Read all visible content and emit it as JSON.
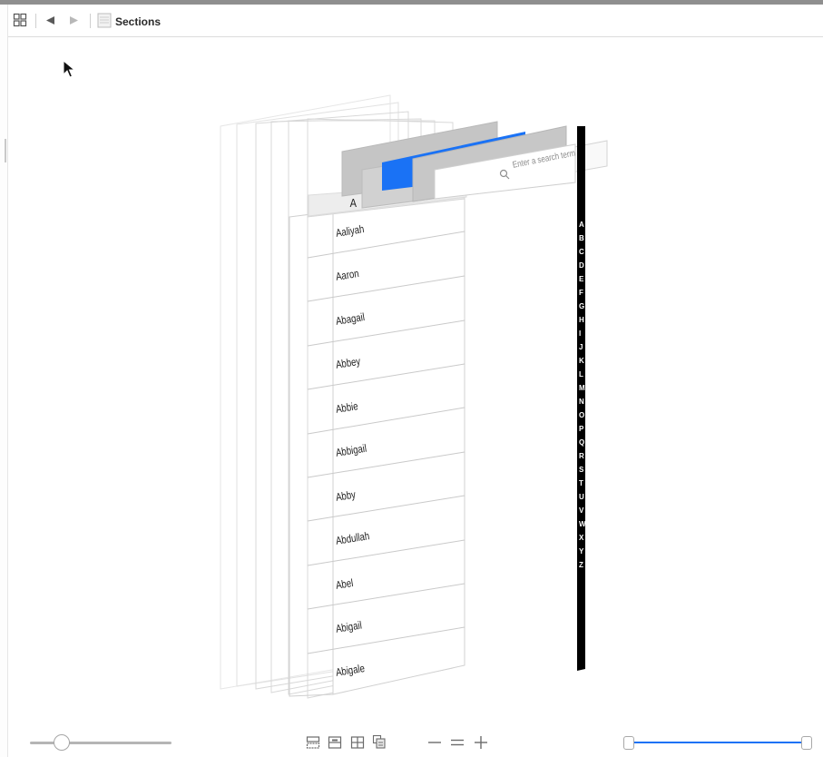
{
  "toolbar": {
    "breadcrumb_label": "Sections"
  },
  "view": {
    "section_header": "A",
    "search_placeholder": "Enter a search term",
    "rows": [
      "Aaliyah",
      "Aaron",
      "Abagail",
      "Abbey",
      "Abbie",
      "Abbigail",
      "Abby",
      "Abdullah",
      "Abel",
      "Abigail",
      "Abigale"
    ],
    "index_letters": [
      "A",
      "B",
      "C",
      "D",
      "E",
      "F",
      "G",
      "H",
      "I",
      "J",
      "K",
      "L",
      "M",
      "N",
      "O",
      "P",
      "Q",
      "R",
      "S",
      "T",
      "U",
      "V",
      "W",
      "X",
      "Y",
      "Z"
    ]
  },
  "bottom": {
    "spacing_slider_value": 0.19,
    "range_slider_min": 0.0,
    "range_slider_max": 1.0
  },
  "colors": {
    "accent": "#1a72f5",
    "index_bar": "#000000",
    "header_gray": "#c7c7c7"
  },
  "icons": [
    "grid-icon",
    "back-arrow-icon",
    "forward-arrow-icon",
    "sections-thumb-icon",
    "cursor-icon",
    "magnifier-icon",
    "layout-hierarchy-icon",
    "layout-split-icon",
    "layout-grid-icon",
    "layout-stack-icon",
    "zoom-out-icon",
    "zoom-reset-icon",
    "zoom-in-icon"
  ]
}
